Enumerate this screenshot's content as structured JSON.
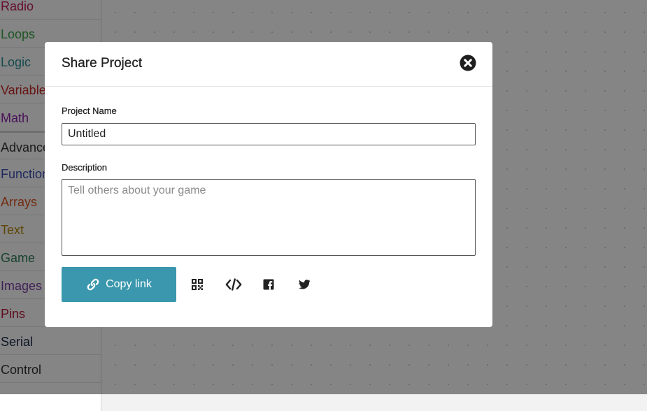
{
  "toolbox": {
    "items": [
      {
        "label": "Radio",
        "color": "#c2185b"
      },
      {
        "label": "Loops",
        "color": "#3ba346"
      },
      {
        "label": "Logic",
        "color": "#2b8f98"
      },
      {
        "label": "Variables",
        "color": "#c62828"
      },
      {
        "label": "Math",
        "color": "#8e24aa"
      },
      {
        "label": "Advanced",
        "color": "#333333"
      },
      {
        "label": "Functions",
        "color": "#3f51b5"
      },
      {
        "label": "Arrays",
        "color": "#d9541e"
      },
      {
        "label": "Text",
        "color": "#b8860b"
      },
      {
        "label": "Game",
        "color": "#2e7d56"
      },
      {
        "label": "Images",
        "color": "#7b3ea6"
      },
      {
        "label": "Pins",
        "color": "#b71c3c"
      },
      {
        "label": "Serial",
        "color": "#1a2a4a"
      },
      {
        "label": "Control",
        "color": "#333333"
      }
    ]
  },
  "modal": {
    "title": "Share Project",
    "close_icon": "close-circle-icon",
    "name_label": "Project Name",
    "name_value": "Untitled",
    "description_label": "Description",
    "description_placeholder": "Tell others about your game",
    "copy_button_label": "Copy link",
    "accent_color": "#3a97ad",
    "share_icons": [
      "qr-code-icon",
      "embed-code-icon",
      "facebook-icon",
      "twitter-icon"
    ]
  }
}
